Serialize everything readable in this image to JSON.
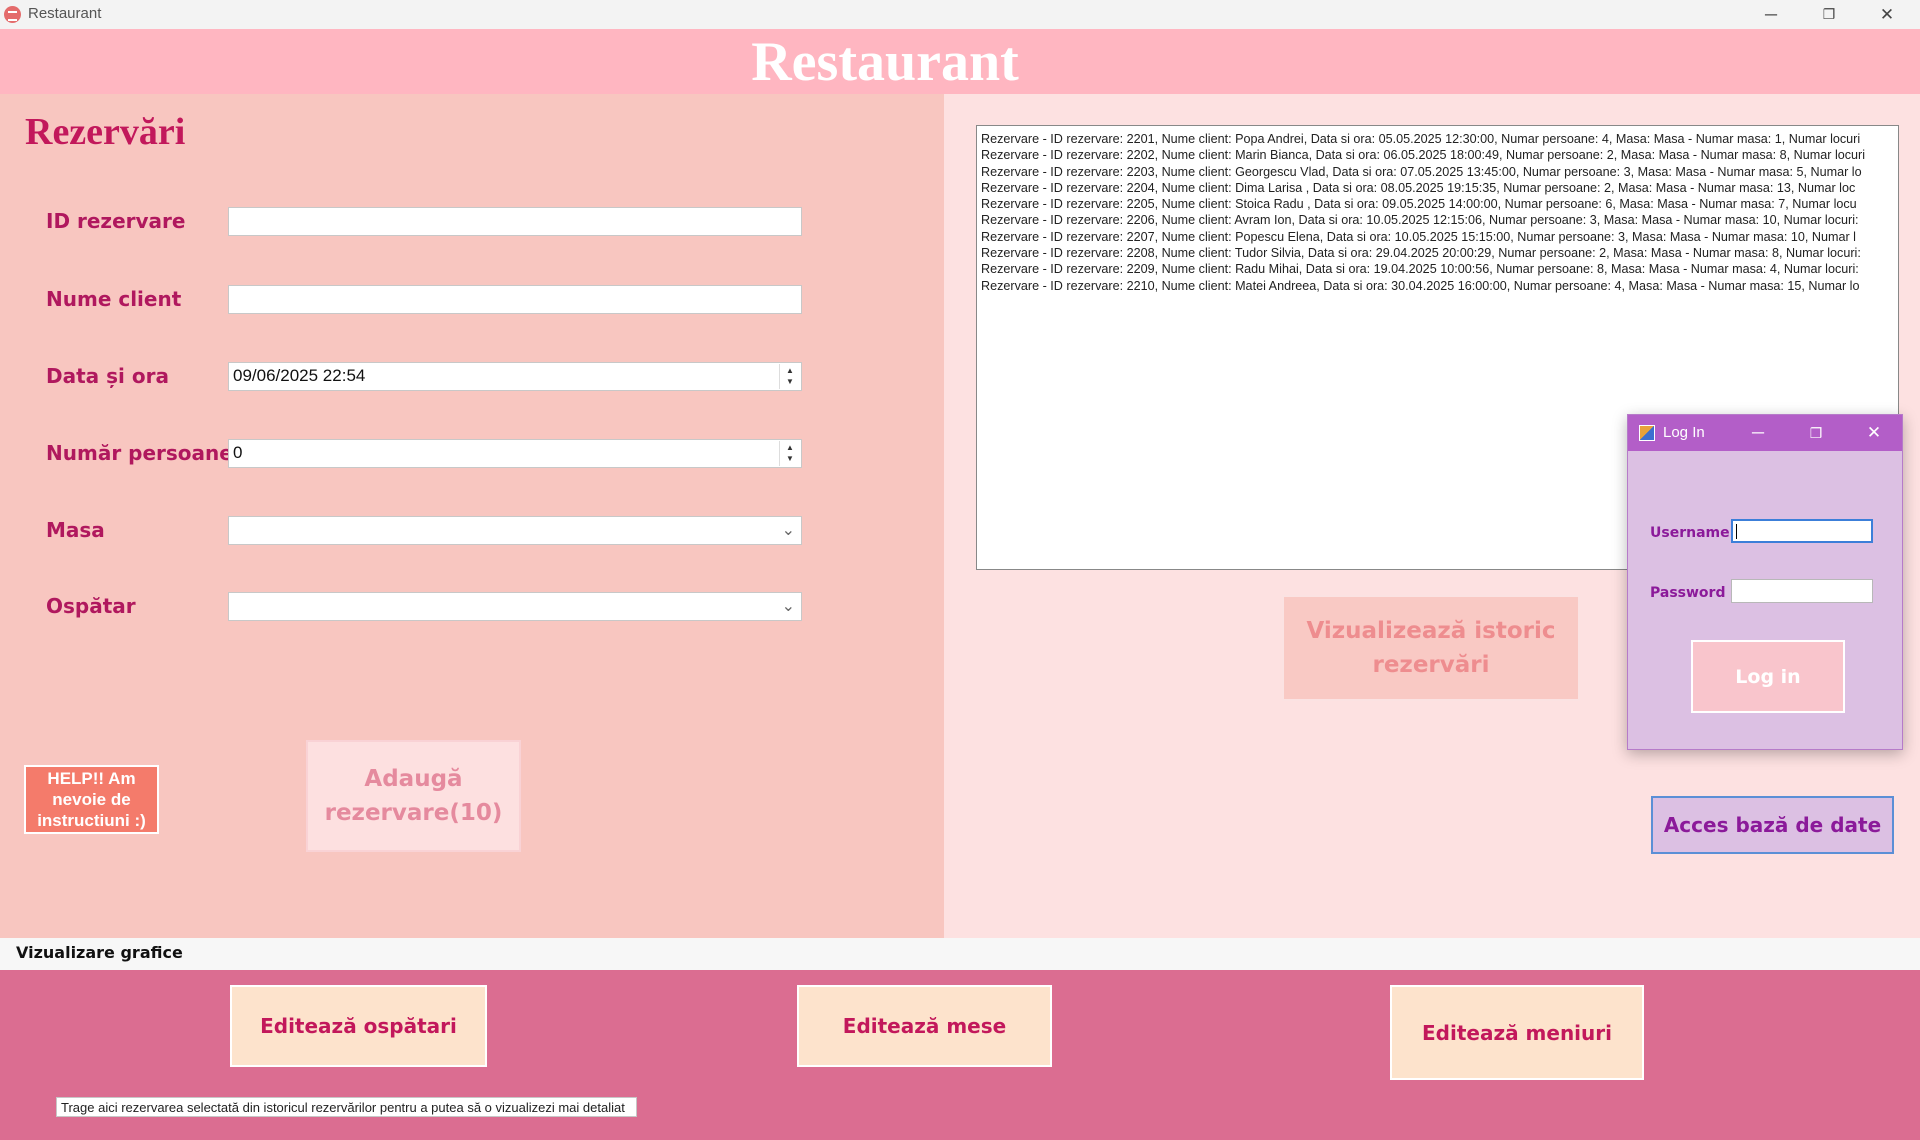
{
  "window": {
    "title": "Restaurant",
    "controls": {
      "minimize": "─",
      "maximize": "❐",
      "close": "✕"
    }
  },
  "header": {
    "title": "Restaurant"
  },
  "form": {
    "section_title": "Rezervări",
    "fields": {
      "id_label": "ID rezervare",
      "id_value": "",
      "client_label": "Nume client",
      "client_value": "",
      "date_label": "Data și ora",
      "date_value": "09/06/2025 22:54",
      "persons_label": "Număr persoane",
      "persons_value": "0",
      "table_label": "Masa",
      "table_value": "",
      "waiter_label": "Ospătar",
      "waiter_value": ""
    },
    "help_button": "HELP!! Am nevoie de instructiuni :)",
    "add_button": "Adaugă rezervare(10)"
  },
  "history": {
    "rows": [
      "Rezervare - ID rezervare: 2201, Nume client: Popa Andrei, Data si ora: 05.05.2025 12:30:00, Numar persoane: 4, Masa: Masa - Numar masa: 1, Numar locuri",
      "Rezervare - ID rezervare: 2202, Nume client: Marin Bianca, Data si ora: 06.05.2025 18:00:49, Numar persoane: 2, Masa: Masa - Numar masa: 8, Numar locuri",
      "Rezervare - ID rezervare: 2203, Nume client: Georgescu Vlad, Data si ora: 07.05.2025 13:45:00, Numar persoane: 3, Masa: Masa - Numar masa: 5, Numar lo",
      "Rezervare - ID rezervare: 2204, Nume client: Dima Larisa , Data si ora: 08.05.2025 19:15:35, Numar persoane: 2, Masa: Masa - Numar masa: 13, Numar loc",
      "Rezervare - ID rezervare: 2205, Nume client: Stoica Radu , Data si ora: 09.05.2025 14:00:00, Numar persoane: 6, Masa: Masa - Numar masa: 7, Numar locu",
      "Rezervare - ID rezervare: 2206, Nume client: Avram Ion, Data si ora: 10.05.2025 12:15:06, Numar persoane: 3, Masa: Masa - Numar masa: 10, Numar locuri:",
      "Rezervare - ID rezervare: 2207, Nume client: Popescu Elena, Data si ora: 10.05.2025 15:15:00, Numar persoane: 3, Masa: Masa - Numar masa: 10, Numar l",
      "Rezervare - ID rezervare: 2208, Nume client: Tudor Silvia, Data si ora: 29.04.2025 20:00:29, Numar persoane: 2, Masa: Masa - Numar masa: 8, Numar locuri:",
      "Rezervare - ID rezervare: 2209, Nume client: Radu Mihai, Data si ora: 19.04.2025 10:00:56, Numar persoane: 8, Masa: Masa - Numar masa: 4, Numar locuri:",
      "Rezervare - ID rezervare: 2210, Nume client: Matei Andreea, Data si ora: 30.04.2025 16:00:00, Numar persoane: 4, Masa: Masa - Numar masa: 15, Numar lo"
    ],
    "view_button": "Vizualizează istoric rezervări"
  },
  "database_button": "Acces bază de date",
  "login": {
    "title": "Log In",
    "username_label": "Username",
    "username_value": "",
    "password_label": "Password",
    "password_value": "",
    "button": "Log in"
  },
  "graphs_label": "Vizualizare grafice",
  "bottom": {
    "edit_waiters": "Editează ospătari",
    "edit_tables": "Editează mese",
    "edit_menus": "Editează meniuri",
    "drop_hint": "Trage aici rezervarea selectată din istoricul rezervărilor pentru a putea să o vizualizezi mai detaliat"
  },
  "colors": {
    "header": "#ffb6c1",
    "left_panel": "#f8c6c0",
    "right_panel": "#fde1e1",
    "bottom_panel": "#db6d91",
    "accent": "#c2185b",
    "login_titlebar": "#b35ec8"
  }
}
